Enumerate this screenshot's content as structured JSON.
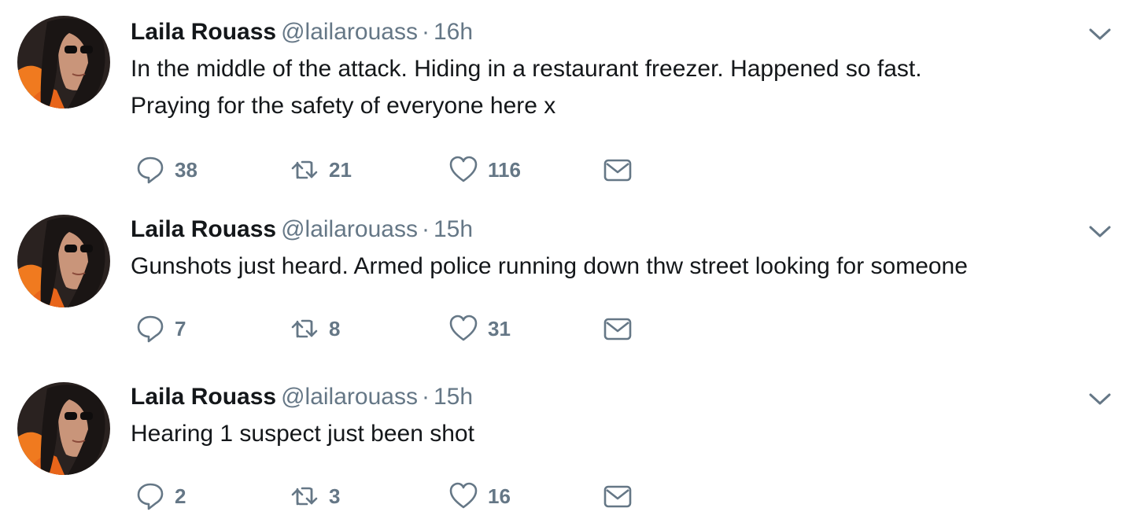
{
  "colors": {
    "secondary": "#657786",
    "text": "#14171a",
    "avatar_accent": "#f07a1f"
  },
  "tweets": [
    {
      "name": "Laila Rouass",
      "handle": "@lailarouass",
      "separator": "·",
      "time": "16h",
      "text": "In the middle of the attack. Hiding in a restaurant freezer. Happened so fast.\nPraying for the safety of everyone here x",
      "replies": "38",
      "retweets": "21",
      "likes": "116"
    },
    {
      "name": "Laila Rouass",
      "handle": "@lailarouass",
      "separator": "·",
      "time": "15h",
      "text": "Gunshots just heard. Armed police running down thw street looking for someone",
      "replies": "7",
      "retweets": "8",
      "likes": "31"
    },
    {
      "name": "Laila Rouass",
      "handle": "@lailarouass",
      "separator": "·",
      "time": "15h",
      "text": "Hearing 1 suspect just been shot",
      "replies": "2",
      "retweets": "3",
      "likes": "16"
    }
  ],
  "icons": {
    "reply": "reply-icon",
    "retweet": "retweet-icon",
    "like": "heart-icon",
    "dm": "envelope-icon",
    "more": "chevron-down-icon"
  }
}
